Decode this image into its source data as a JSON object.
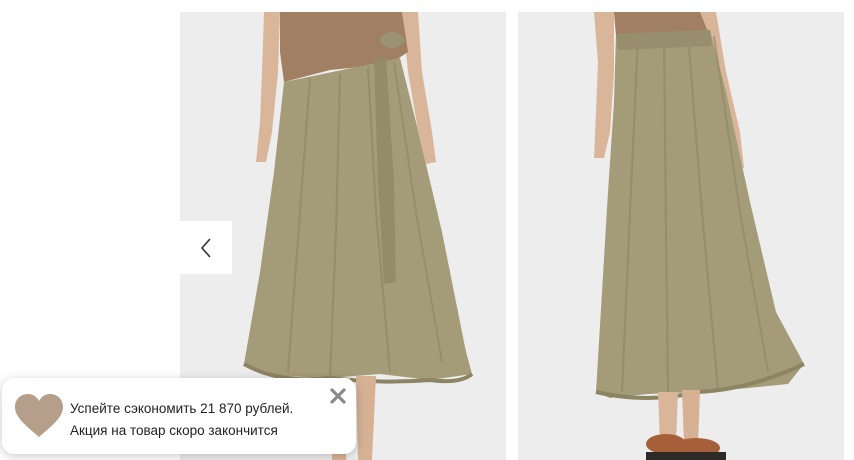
{
  "gallery": {
    "images": [
      {
        "icon": "skirt-front-photo",
        "skirt_color": "#9c9470"
      },
      {
        "icon": "skirt-back-photo",
        "skirt_color": "#9c9470"
      }
    ],
    "prev_icon": "chevron-left-icon"
  },
  "toast": {
    "icon": "heart-icon",
    "icon_color": "#b59f8a",
    "line1": "Успейте сэкономить 21 870 рублей.",
    "line2": "Акция на товар скоро закончится",
    "close_icon": "close-icon"
  }
}
